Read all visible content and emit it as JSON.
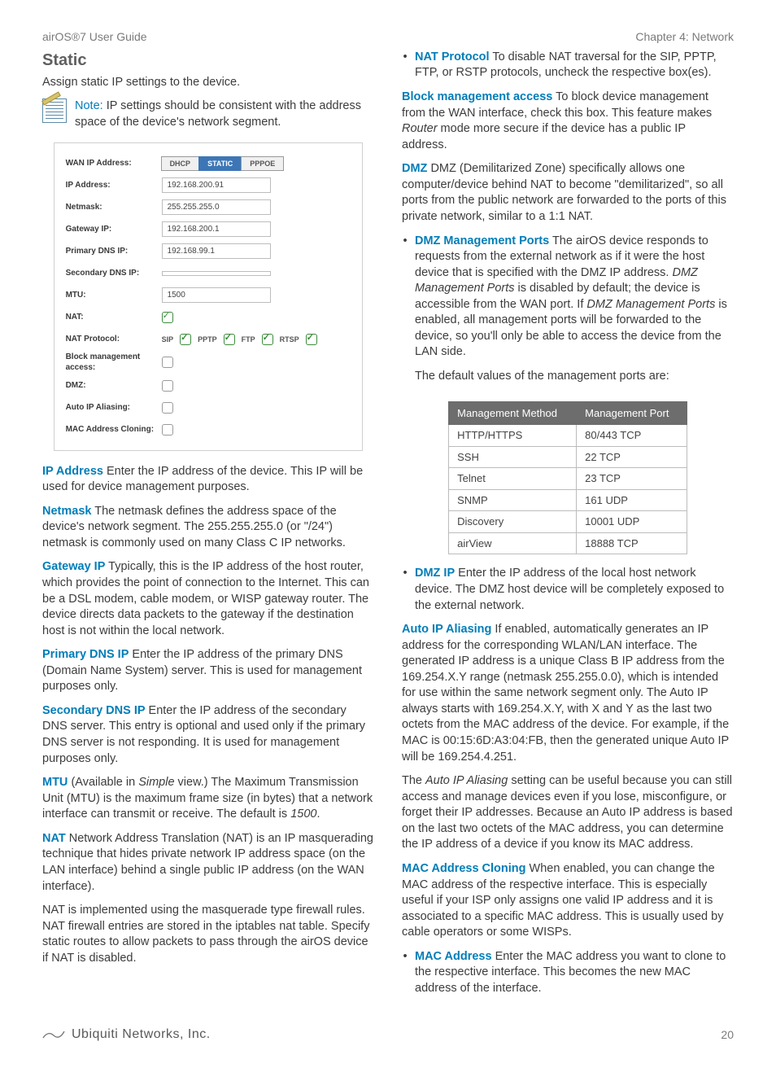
{
  "header": {
    "left": "airOS®7 User Guide",
    "right": "Chapter 4: Network"
  },
  "section": {
    "title": "Static",
    "intro": "Assign static IP settings to the device."
  },
  "note": {
    "label": "Note:",
    "text": " IP settings should be consistent with the address space of the device's network segment."
  },
  "panel": {
    "rows": [
      {
        "label": "WAN IP Address:",
        "type": "tabs"
      },
      {
        "label": "IP Address:",
        "type": "input",
        "value": "192.168.200.91"
      },
      {
        "label": "Netmask:",
        "type": "input",
        "value": "255.255.255.0"
      },
      {
        "label": "Gateway IP:",
        "type": "input",
        "value": "192.168.200.1"
      },
      {
        "label": "Primary DNS IP:",
        "type": "input",
        "value": "192.168.99.1"
      },
      {
        "label": "Secondary DNS IP:",
        "type": "input",
        "value": ""
      },
      {
        "label": "MTU:",
        "type": "input",
        "value": "1500"
      },
      {
        "label": "NAT:",
        "type": "check",
        "checked": true
      },
      {
        "label": "NAT Protocol:",
        "type": "protocols"
      },
      {
        "label": "Block management access:",
        "type": "check-plain",
        "checked": false
      },
      {
        "label": "DMZ:",
        "type": "check-plain",
        "checked": false
      },
      {
        "label": "Auto IP Aliasing:",
        "type": "check-plain",
        "checked": false
      },
      {
        "label": "MAC Address Cloning:",
        "type": "check-plain",
        "checked": false
      }
    ],
    "tabs": [
      "DHCP",
      "STATIC",
      "PPPOE"
    ],
    "tabs_active": 1,
    "protocols": [
      "SIP",
      "PPTP",
      "FTP",
      "RTSP"
    ]
  },
  "defs": {
    "ip_address": {
      "term": "IP Address",
      "body": "  Enter the IP address of the device. This IP will be used for device management purposes."
    },
    "netmask": {
      "term": "Netmask",
      "body": "  The netmask defines the address space of the device's network segment. The 255.255.255.0 (or \"/24\") netmask is commonly used on many Class C IP networks."
    },
    "gateway": {
      "term": "Gateway IP",
      "body": "  Typically, this is the IP address of the host router, which provides the point of connection to the Internet. This can be a DSL modem, cable modem, or WISP gateway router. The device directs data packets to the gateway if the destination host is not within the local network."
    },
    "pdns": {
      "term": "Primary DNS IP",
      "body": "  Enter the IP address of the primary DNS (Domain Name System) server. This is used for management purposes only."
    },
    "sdns": {
      "term": "Secondary DNS IP",
      "body": "  Enter the IP address of the secondary DNS server. This entry is optional and used only if the primary DNS server is not responding. It is used for management purposes only."
    },
    "mtu": {
      "term": "MTU",
      "body_a": "  (Available in ",
      "body_sim": "Simple",
      "body_b": " view.) The Maximum Transmission Unit (MTU) is the maximum frame size (in bytes) that a network interface can transmit or receive. The default is ",
      "body_def": "1500",
      "body_c": "."
    },
    "nat": {
      "term": "NAT",
      "body": "  Network Address Translation (NAT) is an IP masquerading technique that hides private network IP address space (on the LAN interface) behind a single public IP address (on the WAN interface)."
    },
    "nat_p2": "NAT is implemented using the masquerade type firewall rules. NAT firewall entries are stored in the iptables nat table. Specify static routes to allow packets to pass through the airOS device if NAT is disabled.",
    "nat_proto": {
      "term": "NAT Protocol",
      "body": "  To disable NAT traversal for the SIP, PPTP, FTP, or RSTP protocols, uncheck the respective box(es)."
    },
    "block": {
      "term": "Block management access",
      "body_a": "  To block device management from the WAN interface, check this box. This feature makes ",
      "body_it": "Router",
      "body_b": " mode more secure if the device has a public IP address."
    },
    "dmz": {
      "term": "DMZ",
      "body": "  DMZ (Demilitarized Zone) specifically allows one computer/device behind NAT to become \"demilitarized\", so all ports from the public network are forwarded to the ports of this private network, similar to a 1:1 NAT."
    },
    "dmz_mgmt": {
      "term": "DMZ Management Ports",
      "body_a": "  The airOS device responds to requests from the external network as if it were the host device that is specified with the DMZ IP address. ",
      "it1": "DMZ Management Ports",
      "body_b": " is disabled by default; the device is accessible from the WAN port. If ",
      "it2": "DMZ Management Ports",
      "body_c": " is enabled, all management ports will be forwarded to the device, so you'll only be able to access the device from the LAN side."
    },
    "dmz_default": "The default values of the management ports are:",
    "dmz_ip": {
      "term": "DMZ IP",
      "body": "  Enter the IP address of the local host network device. The DMZ host device will be completely exposed to the external network."
    },
    "autoip": {
      "term": "Auto IP Aliasing",
      "body": "  If enabled, automatically generates an IP address for the corresponding WLAN/LAN interface. The generated IP address is a unique Class B IP address from the 169.254.X.Y range (netmask 255.255.0.0), which is intended for use within the same network segment only. The Auto IP always starts with 169.254.X.Y, with X and Y as the last two octets from the MAC address of the device. For example, if the MAC is 00:15:6D:A3:04:FB, then the generated unique Auto IP will be 169.254.4.251."
    },
    "autoip_p2": {
      "pre": "The ",
      "it": "Auto IP Aliasing",
      "post": " setting can be useful because you can still access and manage devices even if you lose, misconfigure, or forget their IP addresses. Because an Auto IP address is based on the last two octets of the MAC address, you can determine the IP address of a device if you know its MAC address."
    },
    "macclone": {
      "term": "MAC Address Cloning",
      "body": "  When enabled, you can change the MAC address of the respective interface. This is especially useful if your ISP only assigns one valid IP address and it is associated to a specific MAC address. This is usually used by cable operators or some WISPs."
    },
    "macaddr": {
      "term": "MAC Address",
      "body": "  Enter the MAC address you want to clone to the respective interface. This becomes the new MAC address of the interface."
    }
  },
  "mgmt_table": {
    "headers": [
      "Management Method",
      "Management Port"
    ],
    "rows": [
      [
        "HTTP/HTTPS",
        "80/443 TCP"
      ],
      [
        "SSH",
        "22 TCP"
      ],
      [
        "Telnet",
        "23 TCP"
      ],
      [
        "SNMP",
        "161 UDP"
      ],
      [
        "Discovery",
        "10001 UDP"
      ],
      [
        "airView",
        "18888 TCP"
      ]
    ]
  },
  "footer": {
    "company": "Ubiquiti Networks, Inc.",
    "page": "20"
  }
}
